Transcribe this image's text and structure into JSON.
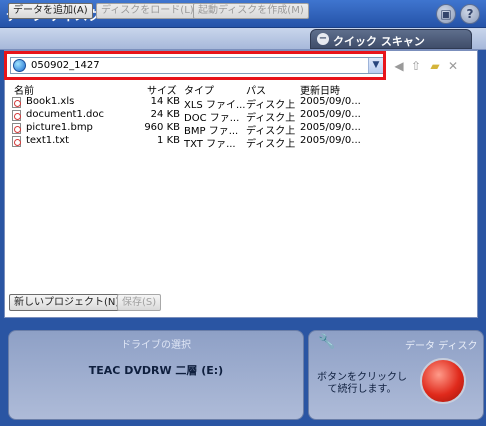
{
  "window": {
    "title": "データ ディスク",
    "buttons": [
      {
        "icon": "save-icon",
        "label": "▣"
      },
      {
        "icon": "help-icon",
        "label": "?"
      }
    ]
  },
  "toolbar": {
    "add_data": "データを追加(A)",
    "load_disc": "ディスクをロード(L)",
    "create_boot_disc": "起動ディスクを作成(M)",
    "quick_scan": "クイック スキャン"
  },
  "address_bar": {
    "value": "050902_1427",
    "highlight_color": "#e8141a"
  },
  "file_list": {
    "columns": [
      "名前",
      "サイズ",
      "タイプ",
      "パス",
      "更新日時"
    ],
    "rows": [
      {
        "name": "Book1.xls",
        "size": "14 KB",
        "type": "XLS ファイ...",
        "path": "ディスク上",
        "modified": "2005/09/0..."
      },
      {
        "name": "document1.doc",
        "size": "24 KB",
        "type": "DOC ファ...",
        "path": "ディスク上",
        "modified": "2005/09/0..."
      },
      {
        "name": "picture1.bmp",
        "size": "960 KB",
        "type": "BMP ファ...",
        "path": "ディスク上",
        "modified": "2005/09/0..."
      },
      {
        "name": "text1.txt",
        "size": "1 KB",
        "type": "TXT ファ...",
        "path": "ディスク上",
        "modified": "2005/09/0..."
      }
    ]
  },
  "bottom_buttons": {
    "new_project": "新しいプロジェクト(N)",
    "save": "保存(S)"
  },
  "drive_panel": {
    "header": "ドライブの選択",
    "drive_name": "TEAC DVDRW 二層 (E:)"
  },
  "action_panel": {
    "title": "データ ディスク",
    "instruction": "ボタンをクリックして続行します。"
  }
}
